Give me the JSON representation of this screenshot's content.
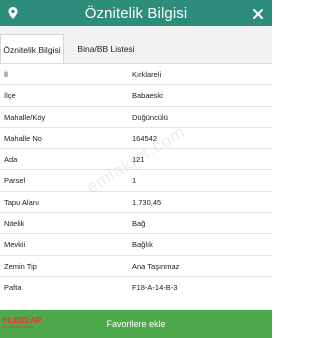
{
  "header": {
    "title": "Öznitelik Bilgisi",
    "left_icon": "location-pin-icon",
    "right_icon": "close-icon",
    "color": "#2e8c7a"
  },
  "tabs": [
    {
      "label": "Öznitelik Bilgisi",
      "active": true
    },
    {
      "label": "Bina/BB Listesi",
      "active": false
    }
  ],
  "rows": [
    {
      "label": "İl",
      "value": "Kırklareli"
    },
    {
      "label": "İlçe",
      "value": "Babaeski"
    },
    {
      "label": "Mahalle/Köy",
      "value": "Düğüncülü"
    },
    {
      "label": "Mahalle No",
      "value": "164542"
    },
    {
      "label": "Ada",
      "value": "121"
    },
    {
      "label": "Parsel",
      "value": "1"
    },
    {
      "label": "Tapu Alanı",
      "value": "1.730,45"
    },
    {
      "label": "Nitelik",
      "value": "Bağ"
    },
    {
      "label": "Mevkii",
      "value": "Bağlık"
    },
    {
      "label": "Zemin Tip",
      "value": "Ana Taşınmaz"
    },
    {
      "label": "Pafta",
      "value": "F18-A-14-B-3"
    }
  ],
  "watermark": "emlakjet.com",
  "footer": {
    "button_label": "Favorilere ekle",
    "color": "#4ea84c"
  },
  "logo": {
    "line1": "YILDIZLAR",
    "line2": "GAYRIMENKUL"
  }
}
